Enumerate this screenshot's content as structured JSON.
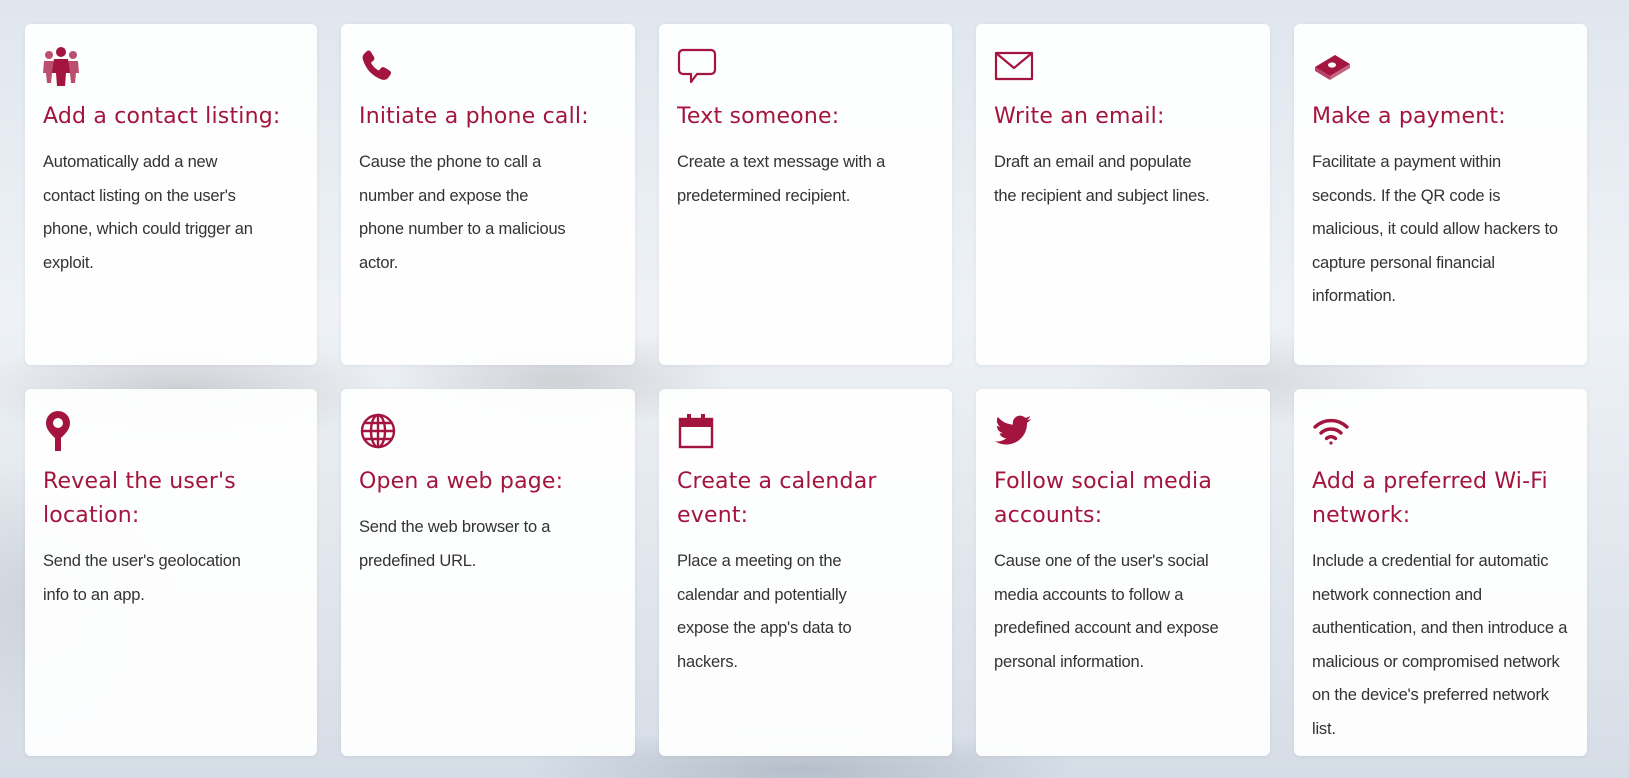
{
  "accent_color": "#a3143f",
  "cards": [
    {
      "icon": "people-group-icon",
      "title": "Add a contact listing:",
      "text": "Automatically add a new contact listing on the user's phone, which could trigger an exploit."
    },
    {
      "icon": "phone-icon",
      "title": "Initiate a phone call:",
      "text": "Cause the phone to call a number and expose the phone number to a malicious actor."
    },
    {
      "icon": "speech-bubble-icon",
      "title": "Text someone:",
      "text": "Create a text message with a predetermined recipient."
    },
    {
      "icon": "envelope-icon",
      "title": "Write an email:",
      "text": "Draft an email and populate the recipient and subject lines."
    },
    {
      "icon": "money-icon",
      "title": "Make a payment:",
      "text": "Facilitate a payment within seconds. If the QR code is malicious, it could allow hackers to capture personal financial information."
    },
    {
      "icon": "location-pin-icon",
      "title": "Reveal the user's location:",
      "text": "Send the user's geolocation info to an app."
    },
    {
      "icon": "globe-icon",
      "title": "Open a web page:",
      "text": "Send the web browser to a predefined URL."
    },
    {
      "icon": "calendar-icon",
      "title": "Create a calendar event:",
      "text": "Place a meeting on the calendar and potentially expose the app's data to hackers."
    },
    {
      "icon": "twitter-bird-icon",
      "title": "Follow social media accounts:",
      "text": "Cause one of the user's social media accounts to follow a predefined account and expose personal information."
    },
    {
      "icon": "wifi-icon",
      "title": "Add a preferred Wi-Fi network:",
      "text": "Include a credential for automatic network connection and authentication, and then introduce a malicious or compromised network on the device's preferred network list."
    }
  ]
}
